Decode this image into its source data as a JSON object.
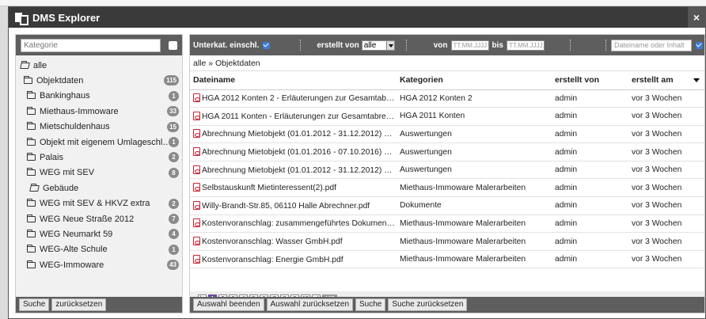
{
  "window": {
    "title": "DMS Explorer",
    "close": "×"
  },
  "left": {
    "category_placeholder": "Kategorie",
    "tree": [
      {
        "label": "alle",
        "indent": 0,
        "open": true,
        "count": ""
      },
      {
        "label": "Objektdaten",
        "indent": 1,
        "open": false,
        "count": "115"
      },
      {
        "label": "Bankinghaus",
        "indent": 2,
        "open": false,
        "count": "1"
      },
      {
        "label": "Miethaus-Immoware",
        "indent": 2,
        "open": false,
        "count": "33"
      },
      {
        "label": "Mietschuldenhaus",
        "indent": 2,
        "open": false,
        "count": "15"
      },
      {
        "label": "Objekt mit eigenem Umlageschl…",
        "indent": 2,
        "open": false,
        "count": "1"
      },
      {
        "label": "Palais",
        "indent": 2,
        "open": false,
        "count": "2"
      },
      {
        "label": "WEG mit SEV",
        "indent": 2,
        "open": false,
        "count": "8"
      },
      {
        "label": "Gebäude",
        "indent": 3,
        "open": true,
        "count": ""
      },
      {
        "label": "WEG mit SEV & HKVZ extra",
        "indent": 2,
        "open": false,
        "count": "2"
      },
      {
        "label": "WEG Neue Straße 2012",
        "indent": 2,
        "open": false,
        "count": "7"
      },
      {
        "label": "WEG Neumarkt 59",
        "indent": 2,
        "open": false,
        "count": "4"
      },
      {
        "label": "WEG-Alte Schule",
        "indent": 2,
        "open": false,
        "count": "1"
      },
      {
        "label": "WEG-Immoware",
        "indent": 2,
        "open": false,
        "count": "43"
      }
    ],
    "btn_search": "Suche",
    "btn_reset": "zurücksetzen"
  },
  "filter": {
    "subcats_label": "Unterkat. einschl.",
    "created_by_label": "erstellt von",
    "created_by_value": "alle",
    "from_label": "von",
    "to_label": "bis",
    "date_placeholder": "TT.MM.JJJJ",
    "search_placeholder": "Dateiname oder Inhalt"
  },
  "breadcrumb": "alle » Objektdaten",
  "table": {
    "columns": [
      "Dateiname",
      "Kategorien",
      "erstellt von",
      "erstellt am"
    ],
    "rows": [
      [
        "HGA 2012 Konten 2 - Erläuterungen zur Gesamtabrech…",
        "HGA 2012 Konten 2",
        "admin",
        "vor 3 Wochen"
      ],
      [
        "HGA 2011 Konten - Erläuterungen zur Gesamtabrechnu…",
        "HGA 2011 Konten",
        "admin",
        "vor 3 Wochen"
      ],
      [
        "Abrechnung Mietobjekt (01.01.2012 - 31.12.2012) brutt…",
        "Auswertungen",
        "admin",
        "vor 3 Wochen"
      ],
      [
        "Abrechnung Mietobjekt (01.01.2016 - 07.10.2016) brutt…",
        "Auswertungen",
        "admin",
        "vor 3 Wochen"
      ],
      [
        "Abrechnung Mietobjekt (01.01.2012 - 31.12.2012) brutt…",
        "Auswertungen",
        "admin",
        "vor 3 Wochen"
      ],
      [
        "Selbstauskunft Mietinteressent(2).pdf",
        "Miethaus-Immoware Malerarbeiten",
        "admin",
        "vor 3 Wochen"
      ],
      [
        "Willy-Brandt-Str.85, 06110 Halle Abrechner.pdf",
        "Dokumente",
        "admin",
        "vor 3 Wochen"
      ],
      [
        "Kostenvoranschlag: zusammengeführtes Dokument.pdf",
        "Miethaus-Immoware Malerarbeiten",
        "admin",
        "vor 3 Wochen"
      ],
      [
        "Kostenvoranschlag: Wasser GmbH.pdf",
        "Miethaus-Immoware Malerarbeiten",
        "admin",
        "vor 3 Wochen"
      ],
      [
        "Kostenvoranschlag: Energie GmbH.pdf",
        "Miethaus-Immoware Malerarbeiten",
        "admin",
        "vor 3 Wochen"
      ]
    ]
  },
  "pager": {
    "first": "|«",
    "pages": [
      "1",
      "2",
      "3",
      "4",
      "5",
      "6",
      "7",
      "8",
      "9",
      "10"
    ],
    "next": "»|",
    "total": "137",
    "current": "1"
  },
  "actions": {
    "end_selection": "Auswahl beenden",
    "reset_selection": "Auswahl zurücksetzen",
    "search": "Suche",
    "reset_search": "Suche zurücksetzen"
  }
}
